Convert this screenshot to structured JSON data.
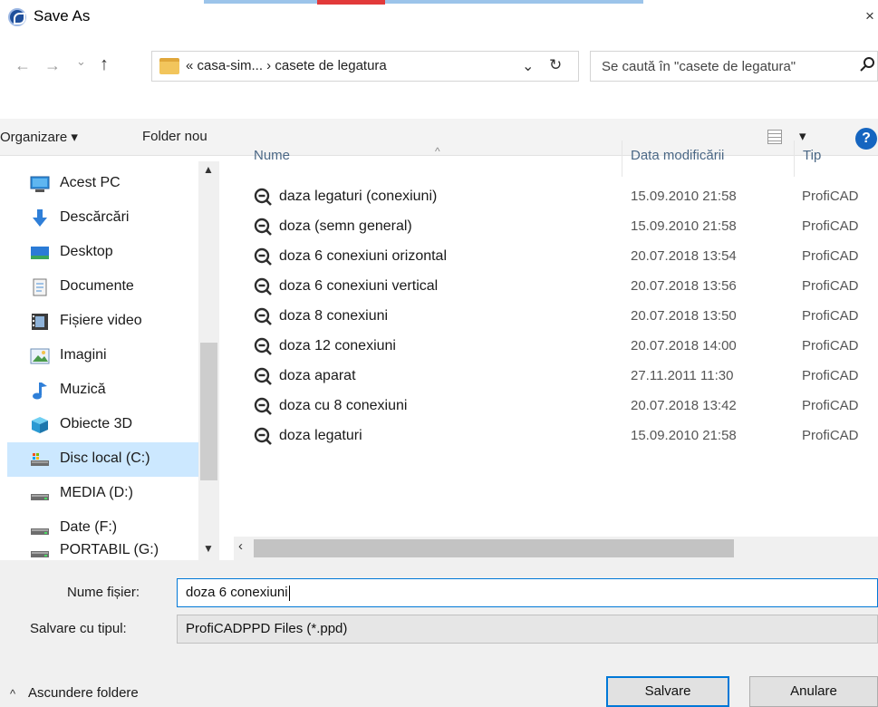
{
  "window": {
    "title": "Save As",
    "close_glyph": "×"
  },
  "nav_buttons": {
    "back_glyph": "←",
    "forward_glyph": "→",
    "recent_glyph": "⌄",
    "up_glyph": "↑"
  },
  "address": {
    "path": "« casa-sim...  ›  casete de legatura",
    "dropdown_glyph": "⌄",
    "refresh_glyph": "↻"
  },
  "search": {
    "placeholder": "Se caută în \"casete de legatura\"",
    "icon": "search-icon"
  },
  "toolbar": {
    "organize_label": "Organizare ▾",
    "new_folder_label": "Folder nou",
    "view_dropdown_glyph": "▾",
    "help_glyph": "?"
  },
  "nav_pane": {
    "items": [
      {
        "label": "Acest PC",
        "icon": "computer-icon"
      },
      {
        "label": "Descărcări",
        "icon": "download-arrow-icon"
      },
      {
        "label": "Desktop",
        "icon": "desktop-icon"
      },
      {
        "label": "Documente",
        "icon": "documents-icon"
      },
      {
        "label": "Fișiere video",
        "icon": "film-icon"
      },
      {
        "label": "Imagini",
        "icon": "pictures-icon"
      },
      {
        "label": "Muzică",
        "icon": "music-note-icon"
      },
      {
        "label": "Obiecte 3D",
        "icon": "cube-3d-icon"
      },
      {
        "label": "Disc local (C:)",
        "icon": "system-drive-icon",
        "selected": true
      },
      {
        "label": "MEDIA (D:)",
        "icon": "drive-icon"
      },
      {
        "label": "Date (F:)",
        "icon": "drive-icon"
      },
      {
        "label": "PORTABIL (G:)",
        "icon": "drive-icon"
      }
    ]
  },
  "file_list": {
    "columns": [
      "Nume",
      "Data modificării",
      "Tip"
    ],
    "rows": [
      {
        "name": "daza legaturi (conexiuni)",
        "date": "15.09.2010 21:58",
        "type": "ProfiCAD"
      },
      {
        "name": "doza (semn general)",
        "date": "15.09.2010 21:58",
        "type": "ProfiCAD"
      },
      {
        "name": "doza 6 conexiuni orizontal",
        "date": "20.07.2018 13:54",
        "type": "ProfiCAD"
      },
      {
        "name": "doza 6 conexiuni vertical",
        "date": "20.07.2018 13:56",
        "type": "ProfiCAD"
      },
      {
        "name": "doza 8 conexiuni",
        "date": "20.07.2018 13:50",
        "type": "ProfiCAD"
      },
      {
        "name": "doza 12 conexiuni",
        "date": "20.07.2018 14:00",
        "type": "ProfiCAD"
      },
      {
        "name": "doza aparat",
        "date": "27.11.2011 11:30",
        "type": "ProfiCAD"
      },
      {
        "name": "doza cu 8 conexiuni",
        "date": "20.07.2018 13:42",
        "type": "ProfiCAD"
      },
      {
        "name": "doza legaturi",
        "date": "15.09.2010 21:58",
        "type": "ProfiCAD"
      }
    ]
  },
  "form": {
    "filename_label": "Nume fișier:",
    "filename_value": "doza 6 conexiuni",
    "filetype_label": "Salvare cu tipul:",
    "filetype_value": "ProfiCADPPD Files (*.ppd)"
  },
  "footer": {
    "hide_folders_label": "Ascundere foldere",
    "save_label": "Salvare",
    "cancel_label": "Anulare"
  }
}
